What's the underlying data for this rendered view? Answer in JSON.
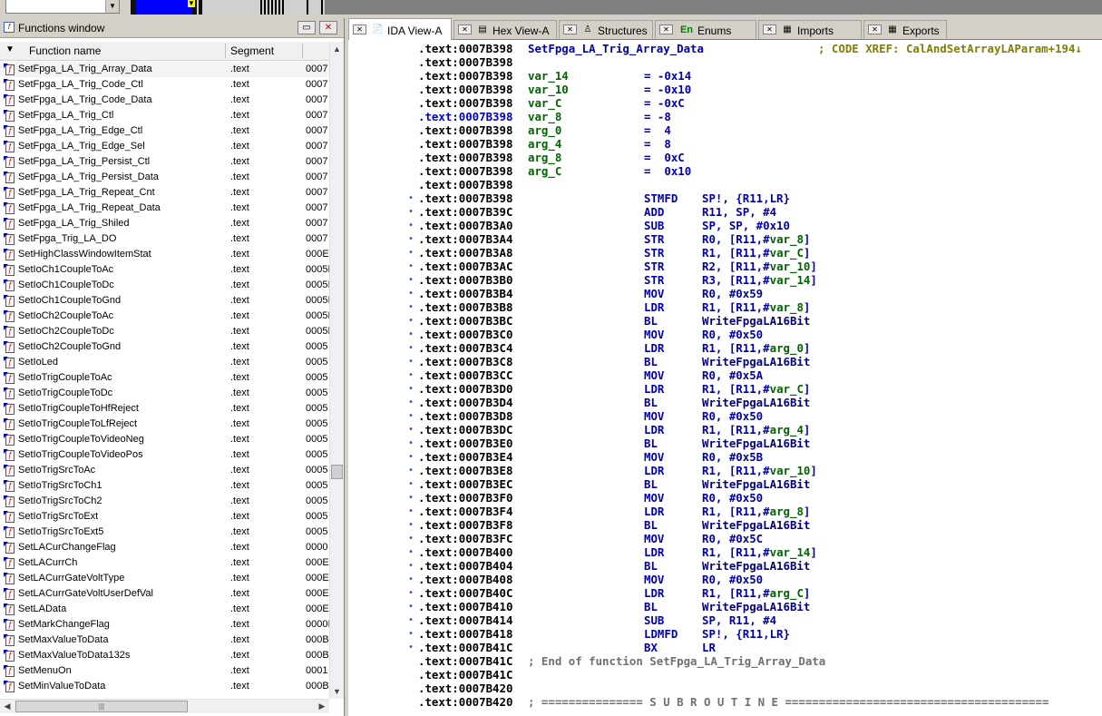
{
  "combo_value": "",
  "functions_window": {
    "title": "Functions window",
    "columns": [
      "Function name",
      "Segment"
    ],
    "rows": [
      {
        "name": "SetFpga_LA_Trig_Array_Data",
        "segment": ".text",
        "addr": "0007"
      },
      {
        "name": "SetFpga_LA_Trig_Code_Ctl",
        "segment": ".text",
        "addr": "0007"
      },
      {
        "name": "SetFpga_LA_Trig_Code_Data",
        "segment": ".text",
        "addr": "0007"
      },
      {
        "name": "SetFpga_LA_Trig_Ctl",
        "segment": ".text",
        "addr": "0007"
      },
      {
        "name": "SetFpga_LA_Trig_Edge_Ctl",
        "segment": ".text",
        "addr": "0007"
      },
      {
        "name": "SetFpga_LA_Trig_Edge_Sel",
        "segment": ".text",
        "addr": "0007"
      },
      {
        "name": "SetFpga_LA_Trig_Persist_Ctl",
        "segment": ".text",
        "addr": "0007"
      },
      {
        "name": "SetFpga_LA_Trig_Persist_Data",
        "segment": ".text",
        "addr": "0007"
      },
      {
        "name": "SetFpga_LA_Trig_Repeat_Cnt",
        "segment": ".text",
        "addr": "0007"
      },
      {
        "name": "SetFpga_LA_Trig_Repeat_Data",
        "segment": ".text",
        "addr": "0007"
      },
      {
        "name": "SetFpga_LA_Trig_Shiled",
        "segment": ".text",
        "addr": "0007"
      },
      {
        "name": "SetFpga_Trig_LA_DO",
        "segment": ".text",
        "addr": "0007"
      },
      {
        "name": "SetHighClassWindowItemStat",
        "segment": ".text",
        "addr": "000E"
      },
      {
        "name": "SetIoCh1CoupleToAc",
        "segment": ".text",
        "addr": "0005D"
      },
      {
        "name": "SetIoCh1CoupleToDc",
        "segment": ".text",
        "addr": "0005I"
      },
      {
        "name": "SetIoCh1CoupleToGnd",
        "segment": ".text",
        "addr": "0005I"
      },
      {
        "name": "SetIoCh2CoupleToAc",
        "segment": ".text",
        "addr": "0005D"
      },
      {
        "name": "SetIoCh2CoupleToDc",
        "segment": ".text",
        "addr": "0005D"
      },
      {
        "name": "SetIoCh2CoupleToGnd",
        "segment": ".text",
        "addr": "0005"
      },
      {
        "name": "SetIoLed",
        "segment": ".text",
        "addr": "0005"
      },
      {
        "name": "SetIoTrigCoupleToAc",
        "segment": ".text",
        "addr": "0005"
      },
      {
        "name": "SetIoTrigCoupleToDc",
        "segment": ".text",
        "addr": "0005"
      },
      {
        "name": "SetIoTrigCoupleToHfReject",
        "segment": ".text",
        "addr": "0005"
      },
      {
        "name": "SetIoTrigCoupleToLfReject",
        "segment": ".text",
        "addr": "0005"
      },
      {
        "name": "SetIoTrigCoupleToVideoNeg",
        "segment": ".text",
        "addr": "0005"
      },
      {
        "name": "SetIoTrigCoupleToVideoPos",
        "segment": ".text",
        "addr": "0005"
      },
      {
        "name": "SetIoTrigSrcToAc",
        "segment": ".text",
        "addr": "0005"
      },
      {
        "name": "SetIoTrigSrcToCh1",
        "segment": ".text",
        "addr": "0005"
      },
      {
        "name": "SetIoTrigSrcToCh2",
        "segment": ".text",
        "addr": "0005"
      },
      {
        "name": "SetIoTrigSrcToExt",
        "segment": ".text",
        "addr": "0005"
      },
      {
        "name": "SetIoTrigSrcToExt5",
        "segment": ".text",
        "addr": "0005"
      },
      {
        "name": "SetLACurChangeFlag",
        "segment": ".text",
        "addr": "0000"
      },
      {
        "name": "SetLACurrCh",
        "segment": ".text",
        "addr": "000E"
      },
      {
        "name": "SetLACurrGateVoltType",
        "segment": ".text",
        "addr": "000E"
      },
      {
        "name": "SetLACurrGateVoltUserDefVal",
        "segment": ".text",
        "addr": "000E"
      },
      {
        "name": "SetLAData",
        "segment": ".text",
        "addr": "000E"
      },
      {
        "name": "SetMarkChangeFlag",
        "segment": ".text",
        "addr": "0000I"
      },
      {
        "name": "SetMaxValueToData",
        "segment": ".text",
        "addr": "000B"
      },
      {
        "name": "SetMaxValueToData132s",
        "segment": ".text",
        "addr": "000B"
      },
      {
        "name": "SetMenuOn",
        "segment": ".text",
        "addr": "0001"
      },
      {
        "name": "SetMinValueToData",
        "segment": ".text",
        "addr": "000B"
      }
    ]
  },
  "tabs": [
    {
      "label": "IDA View-A",
      "icon": "ida-view-icon",
      "glyph": "📄",
      "active": true
    },
    {
      "label": "Hex View-A",
      "icon": "hex-view-icon",
      "glyph": "▤",
      "active": false
    },
    {
      "label": "Structures",
      "icon": "structures-icon",
      "glyph": "♙",
      "active": false
    },
    {
      "label": "Enums",
      "icon": "enums-icon",
      "glyph": "En",
      "active": false
    },
    {
      "label": "Imports",
      "icon": "imports-icon",
      "glyph": "▦",
      "active": false
    },
    {
      "label": "Exports",
      "icon": "exports-icon",
      "glyph": "▦",
      "active": false
    }
  ],
  "disassembly": [
    {
      "addr": ".text:0007B398",
      "kind": "label",
      "text": "SetFpga_LA_Trig_Array_Data",
      "xref": "; CODE XREF: CalAndSetArrayLAParam+194↓"
    },
    {
      "addr": ".text:0007B398",
      "kind": "blank"
    },
    {
      "addr": ".text:0007B398",
      "kind": "var",
      "name": "var_14",
      "value": "= -0x14"
    },
    {
      "addr": ".text:0007B398",
      "kind": "var",
      "name": "var_10",
      "value": "= -0x10"
    },
    {
      "addr": ".text:0007B398",
      "kind": "var",
      "name": "var_C",
      "value": "= -0xC"
    },
    {
      "addr": ".text:0007B398",
      "kind": "var",
      "name": "var_8",
      "value": "= -8",
      "highlight": true
    },
    {
      "addr": ".text:0007B398",
      "kind": "var",
      "name": "arg_0",
      "value": "=  4"
    },
    {
      "addr": ".text:0007B398",
      "kind": "var",
      "name": "arg_4",
      "value": "=  8"
    },
    {
      "addr": ".text:0007B398",
      "kind": "var",
      "name": "arg_8",
      "value": "=  0xC"
    },
    {
      "addr": ".text:0007B398",
      "kind": "var",
      "name": "arg_C",
      "value": "=  0x10"
    },
    {
      "addr": ".text:0007B398",
      "kind": "blank"
    },
    {
      "addr": ".text:0007B398",
      "kind": "ins",
      "mn": "STMFD",
      "ops": "SP!, {R11,LR}"
    },
    {
      "addr": ".text:0007B39C",
      "kind": "ins",
      "mn": "ADD",
      "ops": "R11, SP, #4"
    },
    {
      "addr": ".text:0007B3A0",
      "kind": "ins",
      "mn": "SUB",
      "ops": "SP, SP, #0x10"
    },
    {
      "addr": ".text:0007B3A4",
      "kind": "ins",
      "mn": "STR",
      "ops": "R0, [R11,#var_8]"
    },
    {
      "addr": ".text:0007B3A8",
      "kind": "ins",
      "mn": "STR",
      "ops": "R1, [R11,#var_C]"
    },
    {
      "addr": ".text:0007B3AC",
      "kind": "ins",
      "mn": "STR",
      "ops": "R2, [R11,#var_10]"
    },
    {
      "addr": ".text:0007B3B0",
      "kind": "ins",
      "mn": "STR",
      "ops": "R3, [R11,#var_14]"
    },
    {
      "addr": ".text:0007B3B4",
      "kind": "ins",
      "mn": "MOV",
      "ops": "R0, #0x59"
    },
    {
      "addr": ".text:0007B3B8",
      "kind": "ins",
      "mn": "LDR",
      "ops": "R1, [R11,#var_8]"
    },
    {
      "addr": ".text:0007B3BC",
      "kind": "ins",
      "mn": "BL",
      "ops": "WriteFpgaLA16Bit"
    },
    {
      "addr": ".text:0007B3C0",
      "kind": "ins",
      "mn": "MOV",
      "ops": "R0, #0x50"
    },
    {
      "addr": ".text:0007B3C4",
      "kind": "ins",
      "mn": "LDR",
      "ops": "R1, [R11,#arg_0]"
    },
    {
      "addr": ".text:0007B3C8",
      "kind": "ins",
      "mn": "BL",
      "ops": "WriteFpgaLA16Bit"
    },
    {
      "addr": ".text:0007B3CC",
      "kind": "ins",
      "mn": "MOV",
      "ops": "R0, #0x5A"
    },
    {
      "addr": ".text:0007B3D0",
      "kind": "ins",
      "mn": "LDR",
      "ops": "R1, [R11,#var_C]"
    },
    {
      "addr": ".text:0007B3D4",
      "kind": "ins",
      "mn": "BL",
      "ops": "WriteFpgaLA16Bit"
    },
    {
      "addr": ".text:0007B3D8",
      "kind": "ins",
      "mn": "MOV",
      "ops": "R0, #0x50"
    },
    {
      "addr": ".text:0007B3DC",
      "kind": "ins",
      "mn": "LDR",
      "ops": "R1, [R11,#arg_4]"
    },
    {
      "addr": ".text:0007B3E0",
      "kind": "ins",
      "mn": "BL",
      "ops": "WriteFpgaLA16Bit"
    },
    {
      "addr": ".text:0007B3E4",
      "kind": "ins",
      "mn": "MOV",
      "ops": "R0, #0x5B"
    },
    {
      "addr": ".text:0007B3E8",
      "kind": "ins",
      "mn": "LDR",
      "ops": "R1, [R11,#var_10]"
    },
    {
      "addr": ".text:0007B3EC",
      "kind": "ins",
      "mn": "BL",
      "ops": "WriteFpgaLA16Bit"
    },
    {
      "addr": ".text:0007B3F0",
      "kind": "ins",
      "mn": "MOV",
      "ops": "R0, #0x50"
    },
    {
      "addr": ".text:0007B3F4",
      "kind": "ins",
      "mn": "LDR",
      "ops": "R1, [R11,#arg_8]"
    },
    {
      "addr": ".text:0007B3F8",
      "kind": "ins",
      "mn": "BL",
      "ops": "WriteFpgaLA16Bit"
    },
    {
      "addr": ".text:0007B3FC",
      "kind": "ins",
      "mn": "MOV",
      "ops": "R0, #0x5C"
    },
    {
      "addr": ".text:0007B400",
      "kind": "ins",
      "mn": "LDR",
      "ops": "R1, [R11,#var_14]"
    },
    {
      "addr": ".text:0007B404",
      "kind": "ins",
      "mn": "BL",
      "ops": "WriteFpgaLA16Bit"
    },
    {
      "addr": ".text:0007B408",
      "kind": "ins",
      "mn": "MOV",
      "ops": "R0, #0x50"
    },
    {
      "addr": ".text:0007B40C",
      "kind": "ins",
      "mn": "LDR",
      "ops": "R1, [R11,#arg_C]"
    },
    {
      "addr": ".text:0007B410",
      "kind": "ins",
      "mn": "BL",
      "ops": "WriteFpgaLA16Bit"
    },
    {
      "addr": ".text:0007B414",
      "kind": "ins",
      "mn": "SUB",
      "ops": "SP, R11, #4"
    },
    {
      "addr": ".text:0007B418",
      "kind": "ins",
      "mn": "LDMFD",
      "ops": "SP!, {R11,LR}"
    },
    {
      "addr": ".text:0007B41C",
      "kind": "ins",
      "mn": "BX",
      "ops": "LR"
    },
    {
      "addr": ".text:0007B41C",
      "kind": "comment",
      "text": "; End of function SetFpga_LA_Trig_Array_Data"
    },
    {
      "addr": ".text:0007B41C",
      "kind": "blank"
    },
    {
      "addr": ".text:0007B420",
      "kind": "blank"
    },
    {
      "addr": ".text:0007B420",
      "kind": "comment",
      "text": "; =============== S U B R O U T I N E ======================================="
    }
  ],
  "colors": {
    "label": "#0000aa",
    "variable": "#006400",
    "xref": "#808000",
    "comment": "#707070",
    "navigation_band": "#0000ff"
  }
}
